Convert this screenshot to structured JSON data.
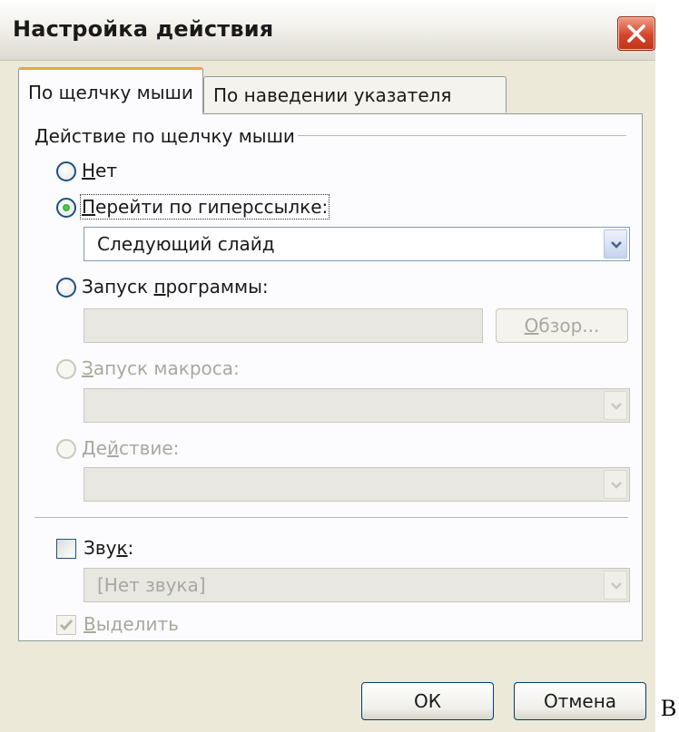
{
  "dialog": {
    "title": "Настройка действия",
    "close_icon": "close-icon"
  },
  "tabs": [
    {
      "label": "По щелчку мыши",
      "active": true
    },
    {
      "label": "По наведении указателя мыши",
      "active": false
    }
  ],
  "group": {
    "label": "Действие по щелчку мыши"
  },
  "options": {
    "none": {
      "label_accel": "Н",
      "label_rest": "ет",
      "selected": false,
      "enabled": true
    },
    "hyperlink": {
      "label_accel": "П",
      "label_rest": "ерейти по гиперссылке:",
      "selected": true,
      "enabled": true
    },
    "hyperlink_combo": {
      "value": "Следующий слайд"
    },
    "run_program": {
      "label_pre": "Запуск ",
      "label_accel": "п",
      "label_rest": "рограммы:",
      "selected": false,
      "enabled": true
    },
    "program_path": {
      "value": ""
    },
    "browse_button": {
      "label_accel": "О",
      "label_rest": "бзор..."
    },
    "run_macro": {
      "label_accel": "З",
      "label_rest": "апуск макроса:",
      "enabled": false
    },
    "macro_combo": {
      "value": ""
    },
    "object_action": {
      "label_pre": "Де",
      "label_accel": "й",
      "label_rest": "ствие:",
      "enabled": false
    },
    "action_combo": {
      "value": ""
    }
  },
  "sound": {
    "label_pre": "Зву",
    "label_accel": "к",
    "label_rest": ":",
    "checked": false,
    "combo_value": "[Нет звука]"
  },
  "highlight": {
    "label_accel": "В",
    "label_rest": "ыделить",
    "checked": true,
    "enabled": false
  },
  "buttons": {
    "ok": "ОК",
    "cancel": "Отмена"
  },
  "side_text": "В",
  "colors": {
    "dialog_bg": "#ece9d8",
    "panel_bg": "#fcfcfe",
    "tab_accent": "#e6a83a",
    "close_red": "#d4462b",
    "radio_selected": "#219b21",
    "disabled_text": "#a9a89e"
  }
}
